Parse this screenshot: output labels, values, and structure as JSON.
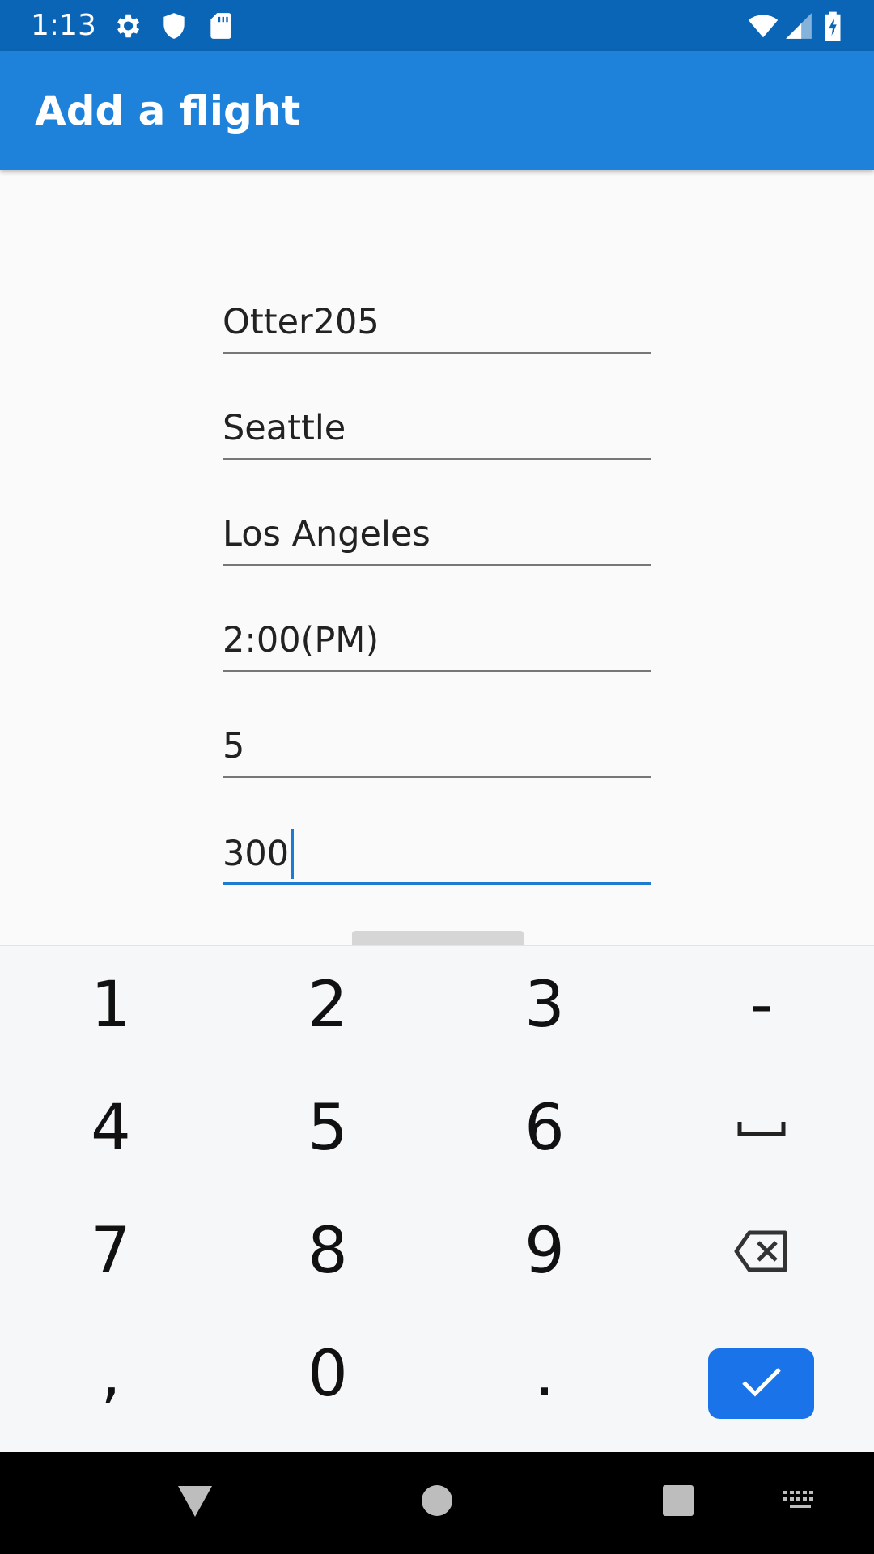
{
  "status_bar": {
    "time": "1:13",
    "icons": [
      "gear-icon",
      "shield-icon",
      "sd-card-icon",
      "wifi-icon",
      "cell-signal-icon",
      "battery-charging-icon"
    ]
  },
  "app_bar": {
    "title": "Add a flight"
  },
  "form": {
    "fields": [
      {
        "value": "Otter205"
      },
      {
        "value": "Seattle"
      },
      {
        "value": "Los Angeles"
      },
      {
        "value": "2:00(PM)"
      },
      {
        "value": "5"
      },
      {
        "value": "300",
        "focused": true
      }
    ]
  },
  "keyboard": {
    "keys": {
      "k1": "1",
      "k2": "2",
      "k3": "3",
      "minus": "-",
      "k4": "4",
      "k5": "5",
      "k6": "6",
      "k7": "7",
      "k8": "8",
      "k9": "9",
      "comma": ",",
      "k0": "0",
      "period": "."
    },
    "icons": [
      "space-icon",
      "backspace-icon",
      "checkmark-icon"
    ],
    "accent_color": "#1a73e8"
  },
  "nav_bar": {
    "icons": [
      "back-icon",
      "home-icon",
      "recents-icon",
      "keyboard-switch-icon"
    ]
  },
  "colors": {
    "status_bar": "#0b65b6",
    "app_bar": "#1e82da",
    "focus_line": "#1e7bd2"
  }
}
